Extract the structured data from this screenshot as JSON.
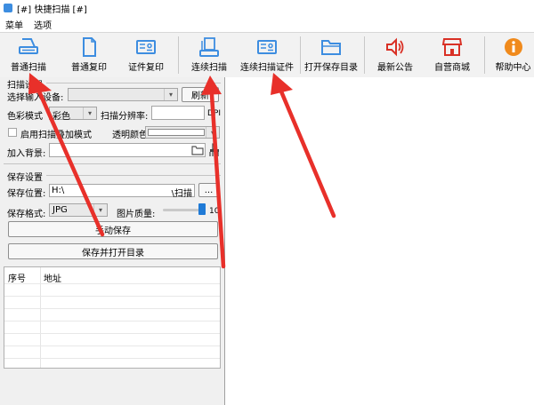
{
  "window": {
    "title": "[#] 快捷扫描 [#]"
  },
  "menubar": {
    "items": [
      "菜单",
      "选项"
    ]
  },
  "toolbar": {
    "buttons": [
      {
        "label": "普通扫描",
        "icon": "scanner-icon"
      },
      {
        "label": "普通复印",
        "icon": "document-icon"
      },
      {
        "label": "证件复印",
        "icon": "id-card-icon"
      },
      {
        "label": "连续扫描",
        "icon": "scanner-stack-icon"
      },
      {
        "label": "连续扫描证件",
        "icon": "id-card-icon"
      },
      {
        "label": "打开保存目录",
        "icon": "folder-icon"
      },
      {
        "label": "最新公告",
        "icon": "speaker-icon"
      },
      {
        "label": "自营商城",
        "icon": "shop-icon"
      },
      {
        "label": "帮助中心",
        "icon": "info-icon"
      }
    ]
  },
  "scan_section": {
    "title": "扫描设置",
    "device_label": "选择输入设备:",
    "device_value": "",
    "refresh_label": "刷新",
    "color_mode_label": "色彩模式",
    "color_mode_value": "彩色",
    "resolution_label": "扫描分辨率:",
    "resolution_value": "",
    "dpi_label": "DPI",
    "overlay_checkbox_label": "启用扫描叠加模式",
    "overlay_checked": false,
    "transparent_color_label": "透明颜色:",
    "background_label": "加入背景:",
    "background_value": ""
  },
  "save_section": {
    "title": "保存设置",
    "location_label": "保存位置:",
    "location_value": "H:\\",
    "location_suffix": "\\扫描",
    "browse_label": "...",
    "format_label": "保存格式:",
    "format_value": "JPG",
    "quality_label": "图片质量:",
    "quality_value": "10",
    "quality_level": 1.0,
    "manual_save_label": "手动保存",
    "save_open_label": "保存并打开目录"
  },
  "table": {
    "columns": [
      "序号",
      "地址"
    ],
    "rows": []
  },
  "colors": {
    "accent": "#3d8de0",
    "annotation_arrow": "#e8302a",
    "toolbar_bg": "#f2f2f2"
  }
}
